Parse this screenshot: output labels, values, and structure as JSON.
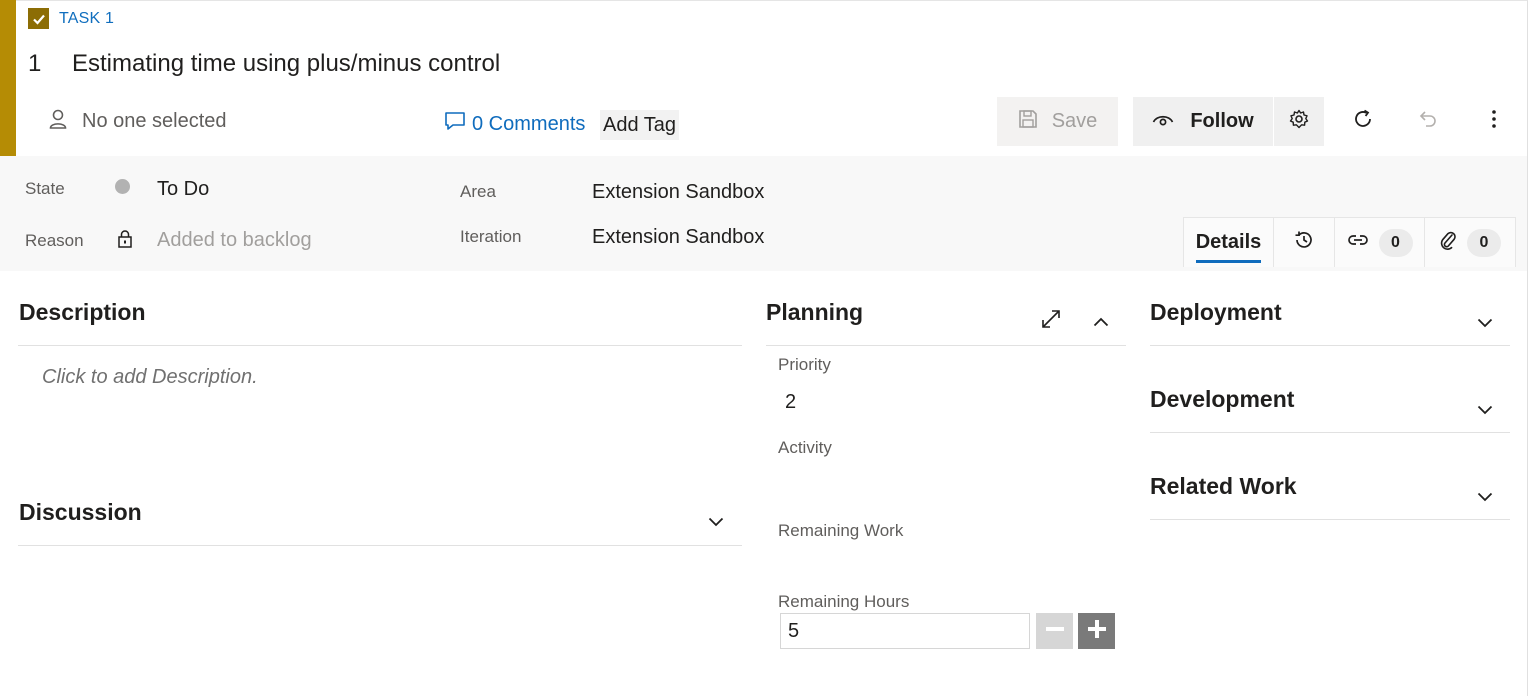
{
  "work_item": {
    "type_label": "TASK 1",
    "id": "1",
    "title": "Estimating time using plus/minus control",
    "assigned_to": "No one selected",
    "comments_label": "0 Comments",
    "add_tag_label": "Add Tag",
    "accent_color": "#b58c05"
  },
  "toolbar": {
    "save_label": "Save",
    "follow_label": "Follow"
  },
  "fields": {
    "state_label": "State",
    "state_value": "To Do",
    "reason_label": "Reason",
    "reason_value": "Added to backlog",
    "area_label": "Area",
    "area_value": "Extension Sandbox",
    "iteration_label": "Iteration",
    "iteration_value": "Extension Sandbox"
  },
  "tabs": {
    "details_label": "Details",
    "links_count": "0",
    "attachments_count": "0"
  },
  "description": {
    "title": "Description",
    "placeholder": "Click to add Description."
  },
  "discussion": {
    "title": "Discussion"
  },
  "planning": {
    "title": "Planning",
    "priority_label": "Priority",
    "priority_value": "2",
    "activity_label": "Activity",
    "activity_value": "",
    "remaining_work_label": "Remaining Work",
    "remaining_work_value": "",
    "remaining_hours_label": "Remaining Hours",
    "remaining_hours_value": "5"
  },
  "side_sections": {
    "deployment": "Deployment",
    "development": "Development",
    "related_work": "Related Work"
  }
}
